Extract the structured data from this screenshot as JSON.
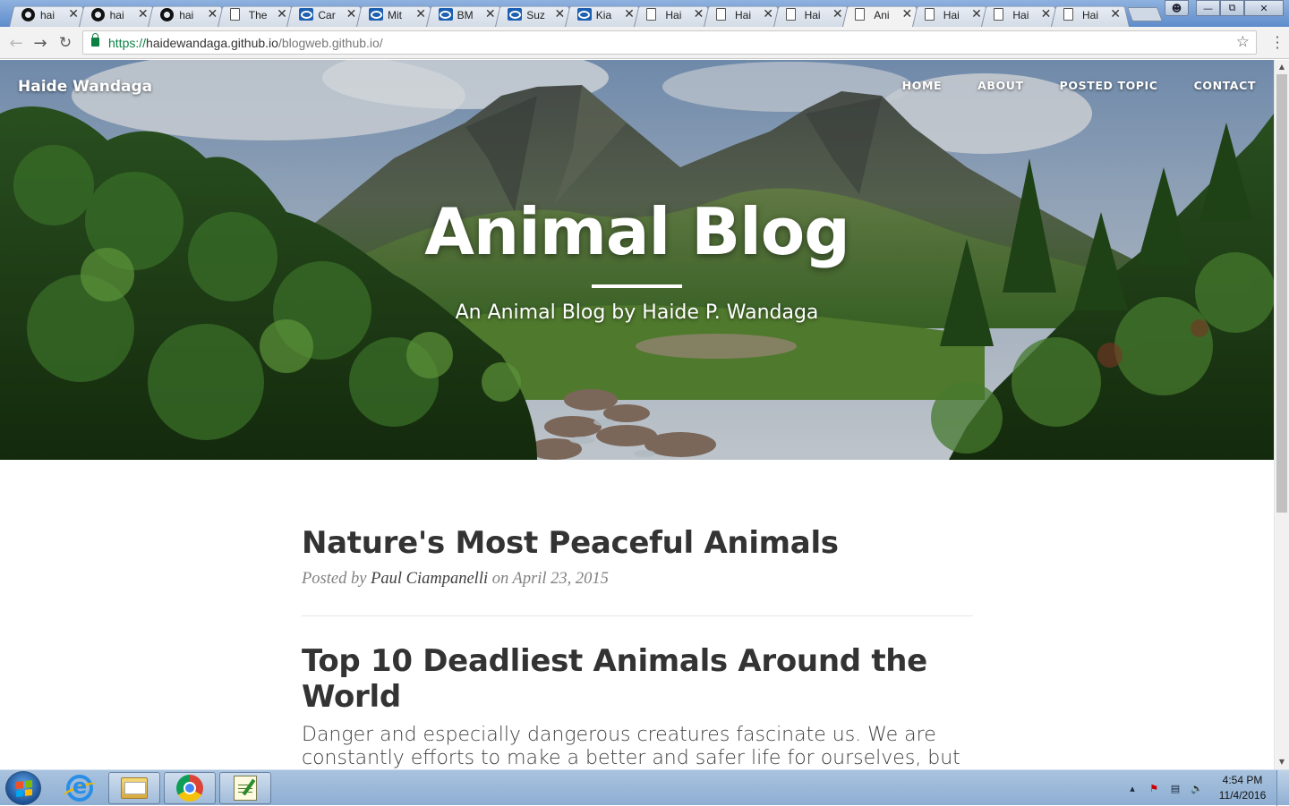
{
  "browser": {
    "tabs": [
      {
        "icon": "github-icon",
        "title": "hai",
        "active": false
      },
      {
        "icon": "github-icon",
        "title": "hai",
        "active": false
      },
      {
        "icon": "github-icon",
        "title": "hai",
        "active": false
      },
      {
        "icon": "document-icon",
        "title": "The",
        "active": false
      },
      {
        "icon": "site-icon",
        "title": "Car",
        "active": false
      },
      {
        "icon": "site-icon",
        "title": "Mit",
        "active": false
      },
      {
        "icon": "site-icon",
        "title": "BM",
        "active": false
      },
      {
        "icon": "site-icon",
        "title": "Suz",
        "active": false
      },
      {
        "icon": "site-icon",
        "title": "Kia",
        "active": false
      },
      {
        "icon": "document-icon",
        "title": "Hai",
        "active": false
      },
      {
        "icon": "document-icon",
        "title": "Hai",
        "active": false
      },
      {
        "icon": "document-icon",
        "title": "Hai",
        "active": false
      },
      {
        "icon": "document-icon",
        "title": "Ani",
        "active": true
      },
      {
        "icon": "document-icon",
        "title": "Hai",
        "active": false
      },
      {
        "icon": "document-icon",
        "title": "Hai",
        "active": false
      },
      {
        "icon": "document-icon",
        "title": "Hai",
        "active": false
      }
    ],
    "url_proto": "https://",
    "url_host": "haidewandaga.github.io",
    "url_path": "/blogweb.github.io/"
  },
  "site": {
    "brand": "Haide Wandaga",
    "nav": [
      "HOME",
      "ABOUT",
      "POSTED TOPIC",
      "CONTACT"
    ],
    "hero_title": "Animal Blog",
    "hero_subtitle": "An Animal Blog by Haide P. Wandaga"
  },
  "posts": [
    {
      "title": "Nature's Most Peaceful Animals",
      "meta_prefix": "Posted by ",
      "author": "Paul Ciampanelli",
      "meta_suffix": " on April 23, 2015"
    },
    {
      "title": "Top 10 Deadliest Animals Around the World",
      "subtitle": "Danger and especially dangerous creatures fascinate us. We are constantly efforts to make a better and safer life for ourselves, but"
    }
  ],
  "taskbar": {
    "clock_time": "4:54 PM",
    "clock_date": "11/4/2016"
  }
}
